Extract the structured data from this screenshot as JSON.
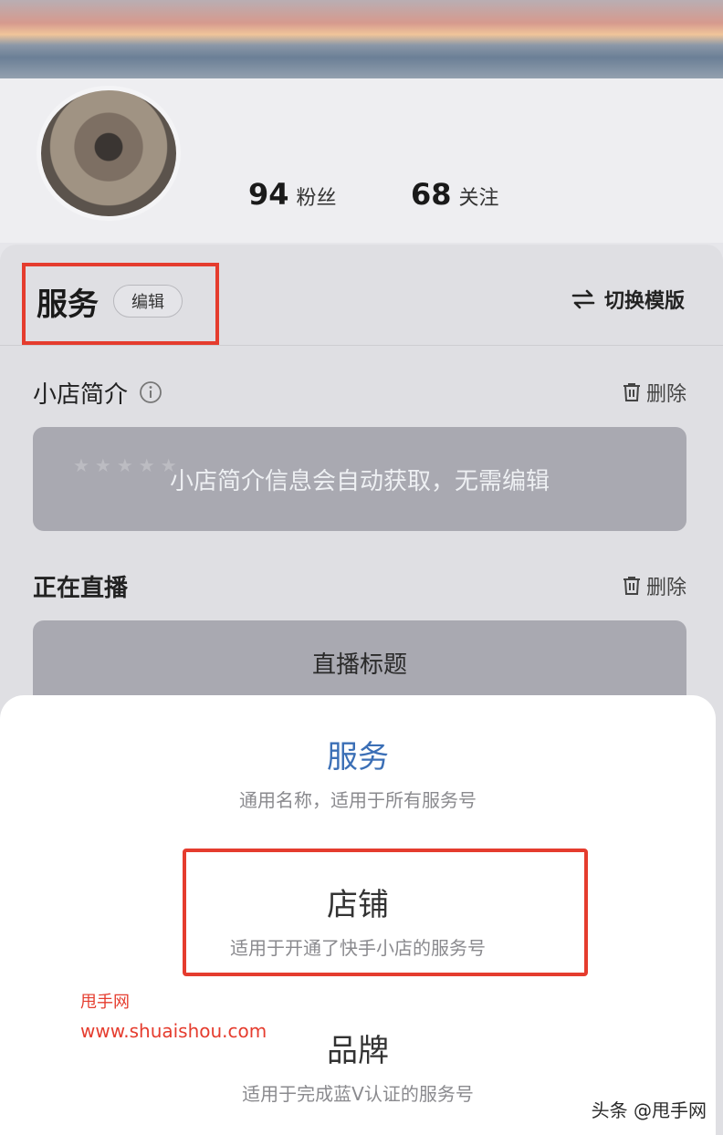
{
  "profile": {
    "fans_count": "94",
    "fans_label": "粉丝",
    "follow_count": "68",
    "follow_label": "关注"
  },
  "service_panel": {
    "title": "服务",
    "edit_label": "编辑",
    "switch_label": "切换模版",
    "intro": {
      "title": "小店简介",
      "delete_label": "删除",
      "card_text": "小店简介信息会自动获取，无需编辑"
    },
    "live": {
      "title": "正在直播",
      "delete_label": "删除",
      "card_text": "直播标题"
    }
  },
  "sheet": {
    "options": [
      {
        "title": "服务",
        "subtitle": "通用名称，适用于所有服务号"
      },
      {
        "title": "店铺",
        "subtitle": "适用于开通了快手小店的服务号"
      },
      {
        "title": "品牌",
        "subtitle": "适用于完成蓝V认证的服务号"
      }
    ]
  },
  "watermark": {
    "name": "甩手网",
    "url": "www.shuaishou.com",
    "corner": "头条 @甩手网"
  },
  "colors": {
    "accent_blue": "#3b6fb6",
    "highlight_red": "#e53c2e"
  }
}
